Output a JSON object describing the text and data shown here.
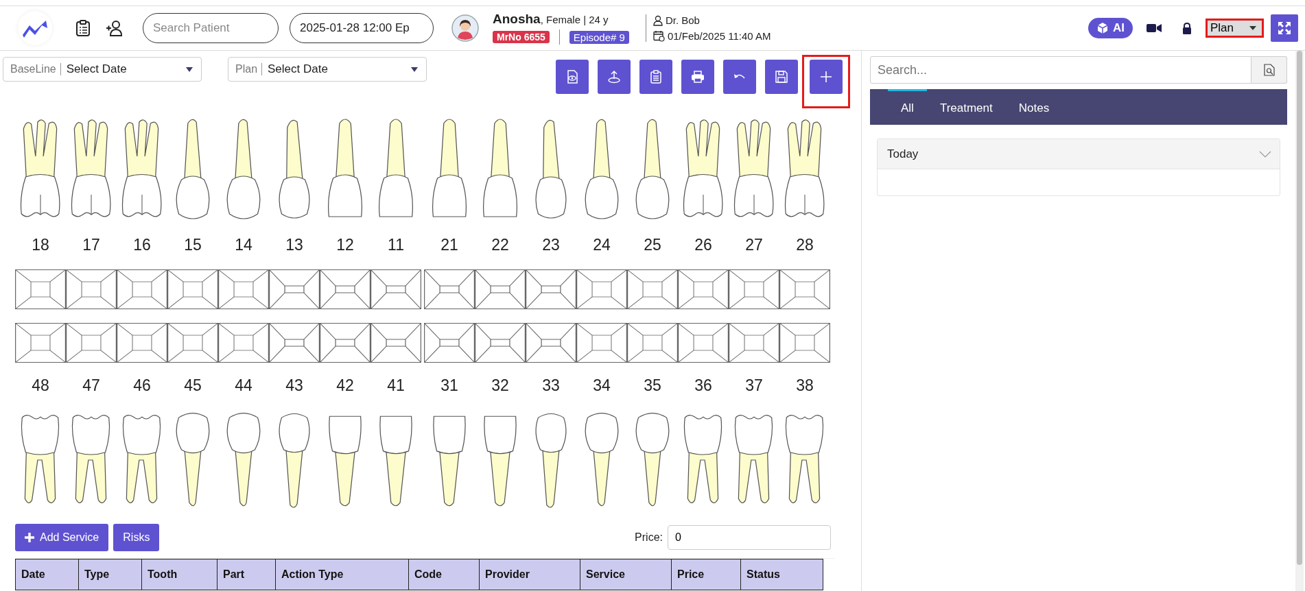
{
  "header": {
    "search_placeholder": "Search Patient",
    "episode_field": "2025-01-28 12:00 Ep",
    "patient_name": "Anosha",
    "patient_details": ", Female | 24 y",
    "mrno": "MrNo 6655",
    "episode": "Episode# 9",
    "doctor": "Dr. Bob",
    "datetime": "01/Feb/2025 11:40 AM",
    "ai_label": "AI",
    "mode": {
      "value": "Plan",
      "highlighted": true
    }
  },
  "filters": [
    {
      "label": "BaseLine",
      "value": "Select Date"
    },
    {
      "label": "Plan",
      "value": "Select Date"
    }
  ],
  "toolbar": [
    {
      "kind": "preview",
      "highlighted": false
    },
    {
      "kind": "upload",
      "highlighted": false
    },
    {
      "kind": "clipboard",
      "highlighted": false
    },
    {
      "kind": "print",
      "highlighted": false
    },
    {
      "kind": "undo",
      "highlighted": false
    },
    {
      "kind": "save",
      "highlighted": false
    },
    {
      "kind": "add",
      "highlighted": true
    }
  ],
  "upper_teeth": [
    {
      "number": "18",
      "kind": "molar"
    },
    {
      "number": "17",
      "kind": "molar"
    },
    {
      "number": "16",
      "kind": "molar"
    },
    {
      "number": "15",
      "kind": "premolar"
    },
    {
      "number": "14",
      "kind": "premolar"
    },
    {
      "number": "13",
      "kind": "canine"
    },
    {
      "number": "12",
      "kind": "incisor"
    },
    {
      "number": "11",
      "kind": "incisor"
    },
    {
      "number": "21",
      "kind": "incisor"
    },
    {
      "number": "22",
      "kind": "incisor"
    },
    {
      "number": "23",
      "kind": "canine"
    },
    {
      "number": "24",
      "kind": "premolar"
    },
    {
      "number": "25",
      "kind": "premolar"
    },
    {
      "number": "26",
      "kind": "molar"
    },
    {
      "number": "27",
      "kind": "molar"
    },
    {
      "number": "28",
      "kind": "molar"
    }
  ],
  "lower_teeth": [
    {
      "number": "48",
      "kind": "molar"
    },
    {
      "number": "47",
      "kind": "molar"
    },
    {
      "number": "46",
      "kind": "molar"
    },
    {
      "number": "45",
      "kind": "premolar"
    },
    {
      "number": "44",
      "kind": "premolar"
    },
    {
      "number": "43",
      "kind": "canine"
    },
    {
      "number": "42",
      "kind": "incisor"
    },
    {
      "number": "41",
      "kind": "incisor"
    },
    {
      "number": "31",
      "kind": "incisor"
    },
    {
      "number": "32",
      "kind": "incisor"
    },
    {
      "number": "33",
      "kind": "canine"
    },
    {
      "number": "34",
      "kind": "premolar"
    },
    {
      "number": "35",
      "kind": "premolar"
    },
    {
      "number": "36",
      "kind": "molar"
    },
    {
      "number": "37",
      "kind": "molar"
    },
    {
      "number": "38",
      "kind": "molar"
    }
  ],
  "service_buttons": [
    {
      "kind": "add",
      "label": "Add Service"
    },
    {
      "kind": "plain",
      "label": "Risks"
    }
  ],
  "price": {
    "label": "Price:",
    "value": "0"
  },
  "table": {
    "columns": [
      "Date",
      "Type",
      "Tooth",
      "Part",
      "Action Type",
      "Code",
      "Provider",
      "Service",
      "Price",
      "Status"
    ]
  },
  "side_panel": {
    "search_placeholder": "Search...",
    "tabs": [
      {
        "label": "All",
        "selected": true
      },
      {
        "label": "Treatment",
        "selected": false
      },
      {
        "label": "Notes",
        "selected": false
      }
    ],
    "sections": [
      {
        "title": "Today"
      }
    ]
  }
}
